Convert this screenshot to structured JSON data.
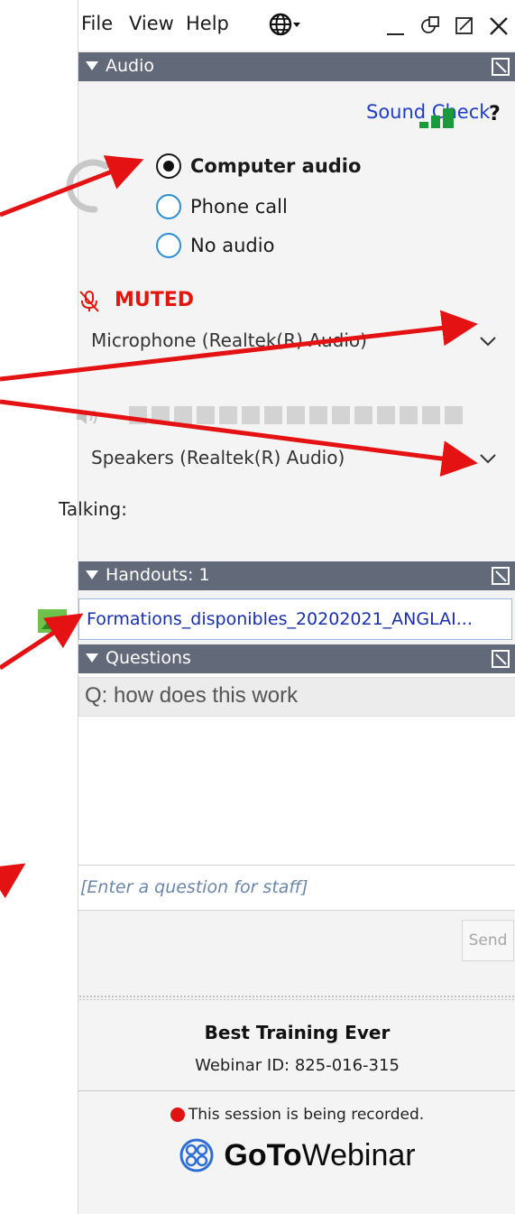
{
  "menu": {
    "file": "File",
    "view": "View",
    "help": "Help",
    "language_icon": "globe-dropdown-icon",
    "window_controls": [
      "minimize-icon",
      "grab-tab-icon",
      "popout-icon",
      "close-icon"
    ]
  },
  "audio": {
    "section_title": "Audio",
    "sound_check": "Sound Check",
    "help": "?",
    "options": [
      {
        "label": "Computer audio",
        "selected": true
      },
      {
        "label": "Phone call",
        "selected": false
      },
      {
        "label": "No audio",
        "selected": false
      }
    ],
    "muted_label": "MUTED",
    "microphone": "Microphone (Realtek(R) Audio)",
    "speakers": "Speakers (Realtek(R) Audio)",
    "talking_label": "Talking:",
    "colors": {
      "accent": "#1f3ec8",
      "muted": "#e4150c",
      "signal": "#1a9a3a"
    }
  },
  "handouts": {
    "section_title": "Handouts: 1",
    "file": "Formations_disponibles_20202021_ANGLAI..."
  },
  "questions": {
    "section_title": "Questions",
    "items": [
      "Q: how does this work"
    ],
    "input_placeholder": "[Enter a question for staff]",
    "send_label": "Send"
  },
  "footer": {
    "title": "Best Training Ever",
    "webinar_id": "Webinar ID: 825-016-315",
    "recording": "This session is being recorded.",
    "brand_bold": "GoTo",
    "brand_light": "Webinar"
  },
  "theme": {
    "section_bar": "#626a7a",
    "annotation_arrow": "#e41212"
  }
}
